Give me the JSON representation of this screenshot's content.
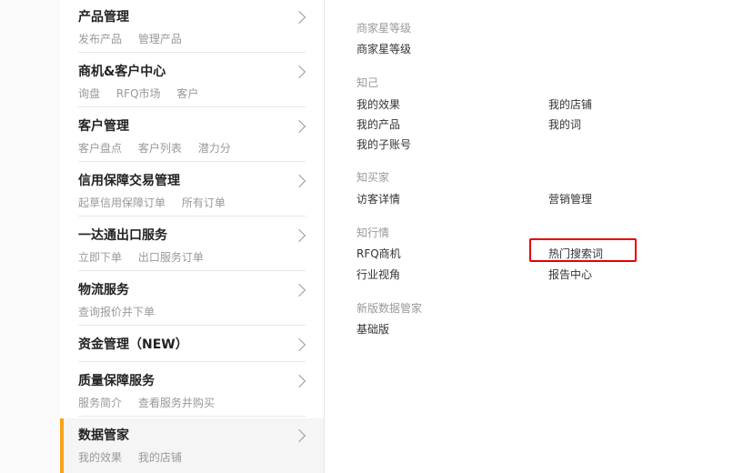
{
  "sidebar": {
    "categories": [
      {
        "title": "产品管理",
        "links": [
          "发布产品",
          "管理产品"
        ]
      },
      {
        "title": "商机&客户中心",
        "links": [
          "询盘",
          "RFQ市场",
          "客户"
        ]
      },
      {
        "title": "客户管理",
        "links": [
          "客户盘点",
          "客户列表",
          "潜力分"
        ]
      },
      {
        "title": "信用保障交易管理",
        "links": [
          "起草信用保障订单",
          "所有订单"
        ]
      },
      {
        "title": "一达通出口服务",
        "links": [
          "立即下单",
          "出口服务订单"
        ]
      },
      {
        "title": "物流服务",
        "links": [
          "查询报价并下单"
        ]
      },
      {
        "title": "资金管理（NEW）",
        "links": []
      },
      {
        "title": "质量保障服务",
        "links": [
          "服务简介",
          "查看服务并购买"
        ]
      },
      {
        "title": "数据管家",
        "links": [
          "我的效果",
          "我的店铺"
        ]
      }
    ],
    "active_index": 8
  },
  "panel": {
    "sections": [
      {
        "title": "商家星等级",
        "links": [
          "商家星等级"
        ]
      },
      {
        "title": "知己",
        "links": [
          "我的效果",
          "我的店铺",
          "我的产品",
          "我的词",
          "我的子账号"
        ]
      },
      {
        "title": "知买家",
        "links": [
          "访客详情",
          "营销管理"
        ]
      },
      {
        "title": "知行情",
        "links": [
          "RFQ商机",
          "热门搜索词",
          "行业视角",
          "报告中心"
        ]
      },
      {
        "title": "新版数据管家",
        "links": [
          "基础版"
        ]
      }
    ],
    "highlighted_link": "热门搜索词"
  },
  "colors": {
    "accent": "#f7a21b",
    "highlight_box": "#e60000"
  }
}
